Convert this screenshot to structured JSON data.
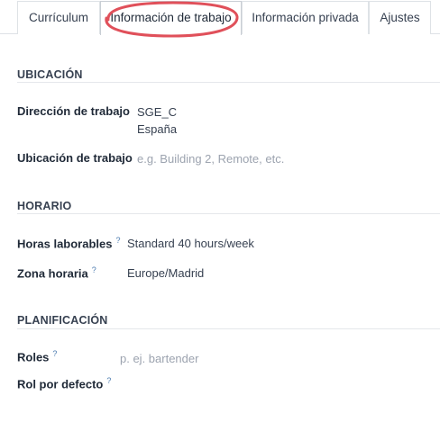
{
  "tabs": [
    {
      "label": "Currículum"
    },
    {
      "label": "Información de trabajo"
    },
    {
      "label": "Información privada"
    },
    {
      "label": "Ajustes"
    }
  ],
  "colors": {
    "highlight_oval": "#e0505a",
    "help_mark": "#4c7cb0"
  },
  "ubicacion": {
    "title": "UBICACIÓN",
    "work_address_label": "Dirección de trabajo",
    "work_address_line1": "SGE_C",
    "work_address_line2": "España",
    "work_location_label": "Ubicación de trabajo",
    "work_location_placeholder": "e.g. Building 2, Remote, etc."
  },
  "horario": {
    "title": "HORARIO",
    "working_hours_label": "Horas laborables",
    "working_hours_value": "Standard 40 hours/week",
    "timezone_label": "Zona horaria",
    "timezone_value": "Europe/Madrid"
  },
  "planificacion": {
    "title": "PLANIFICACIÓN",
    "roles_label": "Roles",
    "roles_placeholder": "p. ej. bartender",
    "default_role_label": "Rol por defecto"
  },
  "help_mark": "?"
}
